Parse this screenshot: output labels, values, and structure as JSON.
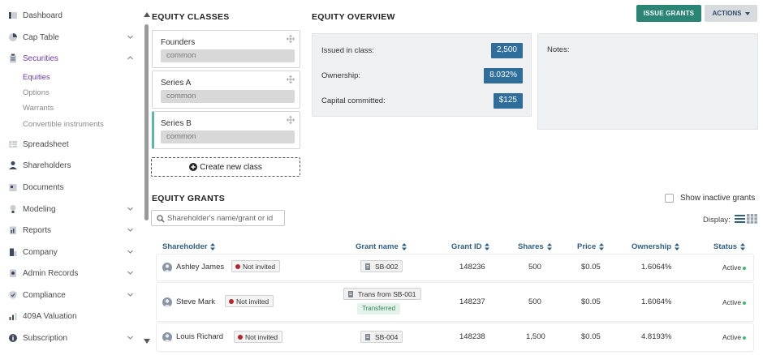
{
  "sidebar": {
    "items": [
      {
        "label": "Dashboard",
        "icon": "dashboard-icon",
        "has_chevron": false
      },
      {
        "label": "Cap Table",
        "icon": "pie-chart-icon",
        "has_chevron": true
      },
      {
        "label": "Securities",
        "icon": "clipboard-icon",
        "has_chevron": true,
        "expanded": true
      },
      {
        "label": "Spreadsheet",
        "icon": "spreadsheet-icon",
        "has_chevron": false
      },
      {
        "label": "Shareholders",
        "icon": "user-icon",
        "has_chevron": false
      },
      {
        "label": "Documents",
        "icon": "document-icon",
        "has_chevron": false
      },
      {
        "label": "Modeling",
        "icon": "bulb-icon",
        "has_chevron": true
      },
      {
        "label": "Reports",
        "icon": "report-icon",
        "has_chevron": true
      },
      {
        "label": "Company",
        "icon": "building-icon",
        "has_chevron": true
      },
      {
        "label": "Admin Records",
        "icon": "records-icon",
        "has_chevron": true
      },
      {
        "label": "Compliance",
        "icon": "shield-icon",
        "has_chevron": true
      },
      {
        "label": "409A Valuation",
        "icon": "valuation-icon",
        "has_chevron": false
      },
      {
        "label": "Subscription",
        "icon": "info-icon",
        "has_chevron": true
      }
    ],
    "securities_sub": [
      {
        "label": "Equities",
        "active": true
      },
      {
        "label": "Options"
      },
      {
        "label": "Warrants"
      },
      {
        "label": "Convertible instruments"
      }
    ]
  },
  "equity_classes": {
    "heading": "EQUITY CLASSES",
    "classes": [
      {
        "name": "Founders",
        "type": "common"
      },
      {
        "name": "Series A",
        "type": "common"
      },
      {
        "name": "Series B",
        "type": "common",
        "selected": true
      }
    ],
    "create_label": "Create new class"
  },
  "overview": {
    "heading": "EQUITY OVERVIEW",
    "issued_label": "Issued in class:",
    "issued_value": "2,500",
    "ownership_label": "Ownership:",
    "ownership_value": "8.032%",
    "capital_label": "Capital committed:",
    "capital_value": "$125",
    "notes_label": "Notes:"
  },
  "toolbar": {
    "issue_grants": "ISSUE GRANTS",
    "actions": "ACTIONS"
  },
  "grants": {
    "heading": "EQUITY GRANTS",
    "search_placeholder": "Shareholder's name/grant or id",
    "show_inactive_label": "Show inactive grants",
    "display_label": "Display:",
    "columns": [
      "Shareholder",
      "Grant name",
      "Grant ID",
      "Shares",
      "Price",
      "Ownership",
      "Status"
    ],
    "rows": [
      {
        "shareholder": "Ashley James",
        "invite": "Not invited",
        "grant_name": "SB-002",
        "grant_id": "148236",
        "shares": "500",
        "price": "$0.05",
        "ownership": "1.6064%",
        "status": "Active"
      },
      {
        "shareholder": "Steve Mark",
        "invite": "Not invited",
        "grant_name": "Trans from SB-001",
        "transfer_tag": "Transferred",
        "grant_id": "148237",
        "shares": "500",
        "price": "$0.05",
        "ownership": "1.6064%",
        "status": "Active"
      },
      {
        "shareholder": "Louis Richard",
        "invite": "Not invited",
        "grant_name": "SB-004",
        "grant_id": "148238",
        "shares": "1,500",
        "price": "$0.05",
        "ownership": "4.8193%",
        "status": "Active"
      }
    ]
  },
  "colors": {
    "accent_purple": "#6a3aa8",
    "issue_button": "#2a8577",
    "value_badge": "#2f6e9b",
    "selected_class": "#5fb8a6",
    "header_blue": "#2f5f86",
    "status_active": "#3cba72",
    "not_invited_dot": "#b3262b"
  }
}
